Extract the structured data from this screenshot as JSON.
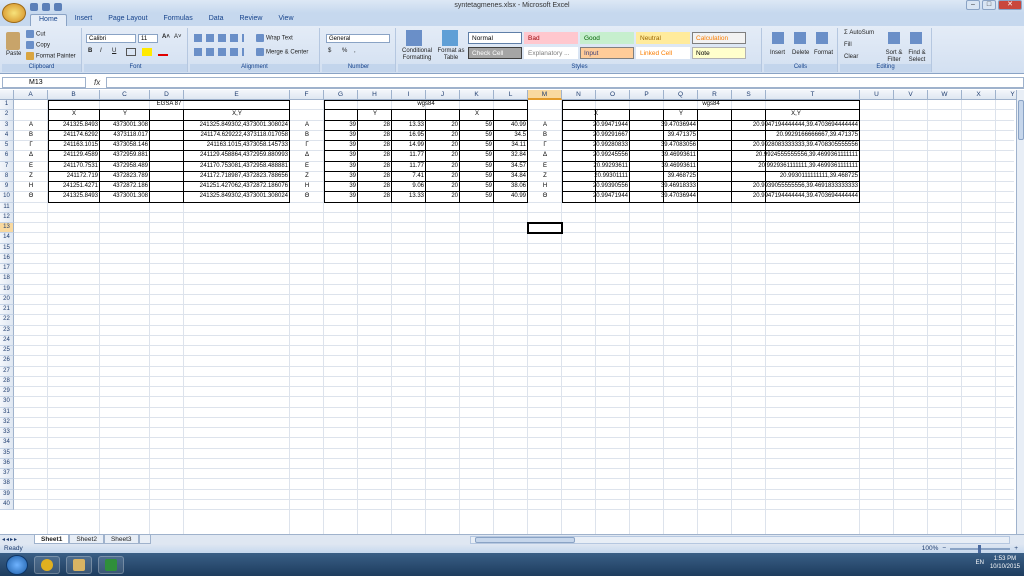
{
  "window": {
    "title": "syntetagmenes.xlsx - Microsoft Excel",
    "min": "–",
    "max": "□",
    "close": "✕"
  },
  "tabs": [
    "Home",
    "Insert",
    "Page Layout",
    "Formulas",
    "Data",
    "Review",
    "View"
  ],
  "ribbon": {
    "clipboard": {
      "paste": "Paste",
      "cut": "Cut",
      "copy": "Copy",
      "format_painter": "Format Painter",
      "label": "Clipboard"
    },
    "font": {
      "name": "Calibri",
      "size": "11",
      "label": "Font",
      "bold": "B",
      "italic": "I",
      "underline": "U",
      "grow": "A˄",
      "shrink": "A˅"
    },
    "alignment": {
      "wrap": "Wrap Text",
      "merge": "Merge & Center",
      "label": "Alignment"
    },
    "number": {
      "format": "General",
      "label": "Number",
      "currency": "$",
      "percent": "%",
      "comma": ","
    },
    "styles": {
      "conditional": "Conditional Formatting",
      "format_table": "Format as Table",
      "label": "Styles",
      "cells": [
        {
          "name": "Normal",
          "bg": "#ffffff",
          "fg": "#000000",
          "border": "#5f7fa8"
        },
        {
          "name": "Bad",
          "bg": "#ffc7ce",
          "fg": "#9c0006",
          "border": "#ffc7ce"
        },
        {
          "name": "Good",
          "bg": "#c6efce",
          "fg": "#006100",
          "border": "#c6efce"
        },
        {
          "name": "Neutral",
          "bg": "#ffeb9c",
          "fg": "#9c6500",
          "border": "#ffeb9c"
        },
        {
          "name": "Calculation",
          "bg": "#f2f2f2",
          "fg": "#fa7d00",
          "border": "#7f7f7f"
        },
        {
          "name": "Check Cell",
          "bg": "#a5a5a5",
          "fg": "#ffffff",
          "border": "#3f3f3f"
        },
        {
          "name": "Explanatory ...",
          "bg": "#ffffff",
          "fg": "#7f7f7f",
          "border": "#ffffff"
        },
        {
          "name": "Input",
          "bg": "#ffcc99",
          "fg": "#3f3f76",
          "border": "#7f7f7f"
        },
        {
          "name": "Linked Cell",
          "bg": "#ffffff",
          "fg": "#fa7d00",
          "border": "#ffffff"
        },
        {
          "name": "Note",
          "bg": "#ffffcc",
          "fg": "#000000",
          "border": "#b2b2b2"
        }
      ]
    },
    "cells": {
      "insert": "Insert",
      "delete": "Delete",
      "format": "Format",
      "label": "Cells"
    },
    "editing": {
      "autosum": "AutoSum",
      "fill": "Fill",
      "clear": "Clear",
      "sort": "Sort & Filter",
      "find": "Find & Select",
      "label": "Editing"
    }
  },
  "formula_bar": {
    "name_box": "M13",
    "fx": "fx",
    "value": ""
  },
  "columns": [
    "A",
    "B",
    "C",
    "D",
    "E",
    "F",
    "G",
    "H",
    "I",
    "J",
    "K",
    "L",
    "M",
    "N",
    "O",
    "P",
    "Q",
    "R",
    "S",
    "T",
    "U",
    "V",
    "W",
    "X",
    "Y"
  ],
  "selected_column": "M",
  "selected_row": 13,
  "rows_visible": 40,
  "sheet": {
    "egsa_title": "EGSA 87",
    "wgs_title_1": "wgs84",
    "wgs_title_2": "wgs84",
    "egsa_headers": {
      "x": "X",
      "y": "Y",
      "xy": "X,Y"
    },
    "wgs_headers": {
      "y": "Y",
      "x": "X"
    },
    "wgs2_headers": {
      "x": "X",
      "y": "Y",
      "xy": "X,Y"
    },
    "rows": [
      {
        "a": "A",
        "b": "241325.8493",
        "c": "4373001.308",
        "e": "241325.849302,4373001.308024",
        "f": "A",
        "g": "39",
        "h": "28",
        "i": "13.33",
        "j": "20",
        "k": "59",
        "l": "40.99",
        "m": "A",
        "n": "20.99471944",
        "p": "39.47036944",
        "s": "20.9947194444444,39.4703694444444"
      },
      {
        "a": "B",
        "b": "241174.6292",
        "c": "4373118.017",
        "e": "241174.629222,4373118.017058",
        "f": "B",
        "g": "39",
        "h": "28",
        "i": "16.95",
        "j": "20",
        "k": "59",
        "l": "34.5",
        "m": "B",
        "n": "20.99291667",
        "p": "39.471375",
        "s": "20.9929166666667,39.471375"
      },
      {
        "a": "Γ",
        "b": "241163.1015",
        "c": "4373058.146",
        "e": "241163.1015,4373058.145733",
        "f": "Γ",
        "g": "39",
        "h": "28",
        "i": "14.99",
        "j": "20",
        "k": "59",
        "l": "34.11",
        "m": "Γ",
        "n": "20.99280833",
        "p": "39.47083056",
        "s": "20.9928083333333,39.4708305555556"
      },
      {
        "a": "Δ",
        "b": "241129.4589",
        "c": "4372959.881",
        "e": "241129.458864,4372959.880993",
        "f": "Δ",
        "g": "39",
        "h": "28",
        "i": "11.77",
        "j": "20",
        "k": "59",
        "l": "32.84",
        "m": "Δ",
        "n": "20.99245556",
        "p": "39.46993611",
        "s": "20.9924555555556,39.4699361111111"
      },
      {
        "a": "E",
        "b": "241170.7531",
        "c": "4372958.489",
        "e": "241170.753081,4372958.488881",
        "f": "E",
        "g": "39",
        "h": "28",
        "i": "11.77",
        "j": "20",
        "k": "59",
        "l": "34.57",
        "m": "E",
        "n": "20.99293611",
        "p": "39.46993611",
        "s": "20.9929361111111,39.4699361111111"
      },
      {
        "a": "Z",
        "b": "241172.719",
        "c": "4372823.789",
        "e": "241172.718987,4372823.788656",
        "f": "Z",
        "g": "39",
        "h": "28",
        "i": "7.41",
        "j": "20",
        "k": "59",
        "l": "34.84",
        "m": "Z",
        "n": "20.99301111",
        "p": "39.468725",
        "s": "20.9930111111111,39.468725"
      },
      {
        "a": "H",
        "b": "241251.4271",
        "c": "4372872.186",
        "e": "241251.427062,4372872.186076",
        "f": "H",
        "g": "39",
        "h": "28",
        "i": "9.06",
        "j": "20",
        "k": "59",
        "l": "38.06",
        "m": "H",
        "n": "20.99390556",
        "p": "39.46918333",
        "s": "20.9939055555556,39.4691833333333"
      },
      {
        "a": "Θ",
        "b": "241325.8493",
        "c": "4373001.308",
        "e": "241325.849302,4373001.308024",
        "f": "Θ",
        "g": "39",
        "h": "28",
        "i": "13.33",
        "j": "20",
        "k": "59",
        "l": "40.99",
        "m": "Θ",
        "n": "20.99471944",
        "p": "39.47036944",
        "s": "20.9947194444444,39.4703694444444"
      }
    ]
  },
  "sheet_tabs": [
    "Sheet1",
    "Sheet2",
    "Sheet3"
  ],
  "active_sheet": "Sheet1",
  "status": {
    "ready": "Ready",
    "zoom": "100%"
  },
  "taskbar": {
    "lang": "EN",
    "time": "1:53 PM",
    "date": "10/10/2015",
    "apps": [
      {
        "name": "chrome",
        "color": "#e0b020"
      },
      {
        "name": "explorer",
        "color": "#d9b463"
      },
      {
        "name": "excel",
        "color": "#2f8f3a"
      }
    ]
  }
}
